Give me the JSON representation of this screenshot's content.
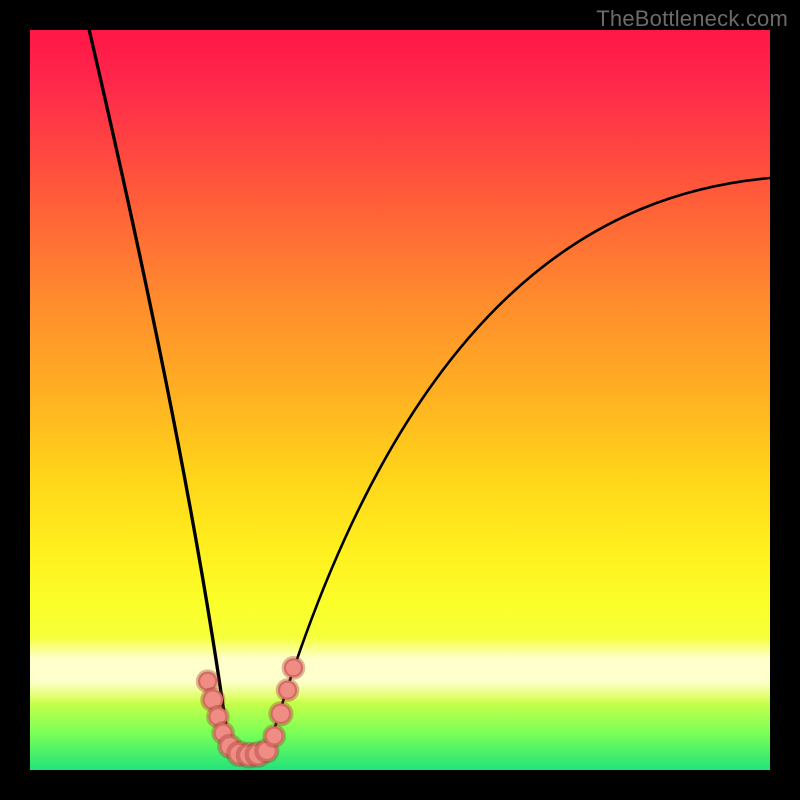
{
  "watermark": "TheBottleneck.com",
  "chart_data": {
    "type": "line",
    "title": "",
    "xlabel": "",
    "ylabel": "",
    "xlim": [
      0,
      100
    ],
    "ylim": [
      0,
      100
    ],
    "grid": false,
    "curve_left": {
      "description": "steep left branch of V curve",
      "x_start": 8,
      "y_start": 100,
      "x_end": 27,
      "y_end": 2,
      "control": {
        "x": 22,
        "y": 40
      }
    },
    "curve_right": {
      "description": "right branch of V curve",
      "x_start": 32,
      "y_start": 2,
      "x_end": 100,
      "y_end": 80,
      "control1": {
        "x": 50,
        "y": 65
      },
      "control2": {
        "x": 78,
        "y": 78
      }
    },
    "valley": {
      "x_from": 27,
      "x_to": 32,
      "y": 2
    },
    "series": [
      {
        "name": "marker-cluster",
        "color": "#ef8c84",
        "points": [
          {
            "x": 24.0,
            "y": 12.0,
            "r": 1.3
          },
          {
            "x": 24.7,
            "y": 9.5,
            "r": 1.4
          },
          {
            "x": 25.4,
            "y": 7.2,
            "r": 1.3
          },
          {
            "x": 26.1,
            "y": 5.0,
            "r": 1.3
          },
          {
            "x": 27.0,
            "y": 3.2,
            "r": 1.4
          },
          {
            "x": 28.3,
            "y": 2.2,
            "r": 1.5
          },
          {
            "x": 29.6,
            "y": 2.0,
            "r": 1.5
          },
          {
            "x": 30.8,
            "y": 2.1,
            "r": 1.5
          },
          {
            "x": 32.0,
            "y": 2.6,
            "r": 1.4
          },
          {
            "x": 33.0,
            "y": 4.6,
            "r": 1.3
          },
          {
            "x": 33.9,
            "y": 7.6,
            "r": 1.4
          },
          {
            "x": 34.8,
            "y": 10.8,
            "r": 1.3
          },
          {
            "x": 35.6,
            "y": 13.8,
            "r": 1.3
          }
        ]
      }
    ]
  }
}
